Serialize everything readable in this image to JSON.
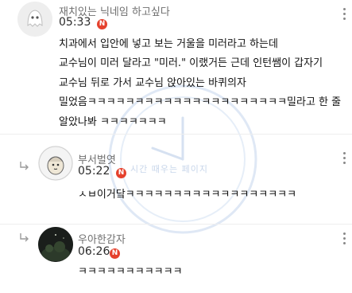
{
  "comments": [
    {
      "author": "재치있는 닉네임 하고싶다",
      "time": "05:33",
      "new_badge": "N",
      "lines": [
        "치과에서 입안에 넣고 보는 거울을 미러라고 하는데",
        "교수님이 미러 달라고 \"미러.\" 이랬거든 근데 인턴쌤이 갑자기",
        "교수님 뒤로 가서 교수님 앉아있는 바퀴의자",
        "밀었음ㅋㅋㅋㅋㅋㅋㅋㅋㅋㅋㅋㅋㅋㅋㅋㅋㅋㅋㅋㅋㅋ밀라고 한 줄",
        "알았나봐 ㅋㅋㅋㅋㅋㅋㅋ"
      ]
    },
    {
      "author": "부서벌엿",
      "time": "05:22",
      "new_badge": "N",
      "text": "ㅅㅂ이거닼ㅋㅋㅋㅋㅋㅋㅋㅋㅋㅋㅋㅋㅋㅋㅋㅋㅋㅋ"
    },
    {
      "author": "우아한감자",
      "time": "06:26",
      "new_badge": "N",
      "text": "ㅋㅋㅋㅋㅋㅋㅋㅋㅋㅋㅋ"
    }
  ],
  "watermark": "시간 때우는 페이지",
  "colors": {
    "badge": "#e5412d",
    "name": "#6f6f6f",
    "divider": "#eeeeee"
  },
  "icons": [
    "ghost-avatar-icon",
    "character-avatar-icon",
    "reply-arrow-icon",
    "more-vertical-icon",
    "clock-watermark-icon"
  ]
}
